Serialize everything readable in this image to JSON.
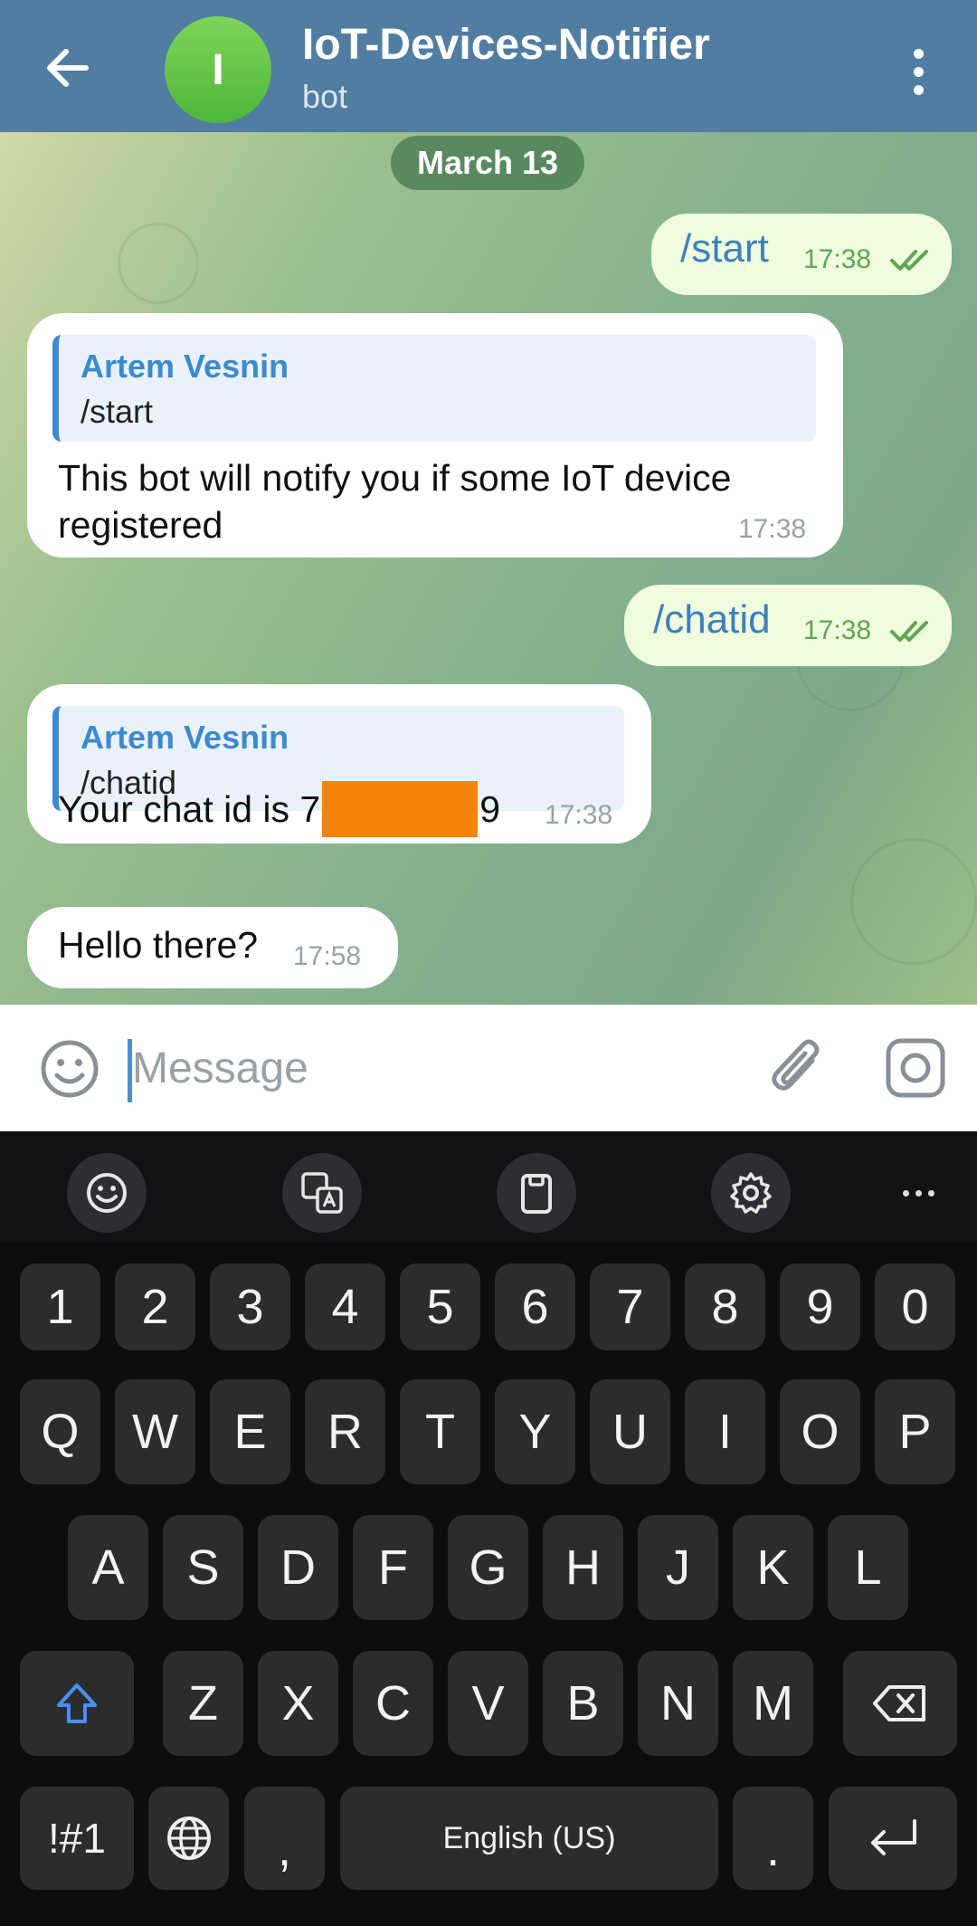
{
  "header": {
    "title": "IoT-Devices-Notifier",
    "subtitle": "bot",
    "avatar_letter": "I",
    "colors": {
      "bar": "#517da2",
      "avatar": "#5ec44a"
    }
  },
  "chat": {
    "date_label": "March 13",
    "messages": [
      {
        "dir": "out",
        "text": "/start",
        "time": "17:38",
        "status": "read"
      },
      {
        "dir": "in",
        "reply_author": "Artem Vesnin",
        "reply_text": "/start",
        "line1": "This bot will notify you if some IoT device",
        "line2": "registered",
        "time": "17:38"
      },
      {
        "dir": "out",
        "text": "/chatid",
        "time": "17:38",
        "status": "read"
      },
      {
        "dir": "in",
        "reply_author": "Artem Vesnin",
        "reply_text": "/chatid",
        "text_prefix": "Your chat id is 7",
        "text_suffix": "9",
        "redacted": true,
        "time": "17:38"
      },
      {
        "dir": "in",
        "text": "Hello there?",
        "time": "17:58"
      }
    ]
  },
  "composer": {
    "placeholder": "Message",
    "icons": [
      "emoji-icon",
      "paperclip-icon",
      "camera-icon"
    ]
  },
  "keyboard": {
    "toolbar_icons": [
      "emoji-icon",
      "translate-icon",
      "clipboard-icon",
      "gear-icon",
      "more-icon"
    ],
    "row_numbers": [
      "1",
      "2",
      "3",
      "4",
      "5",
      "6",
      "7",
      "8",
      "9",
      "0"
    ],
    "row_q": [
      "Q",
      "W",
      "E",
      "R",
      "T",
      "Y",
      "U",
      "I",
      "O",
      "P"
    ],
    "row_a": [
      "A",
      "S",
      "D",
      "F",
      "G",
      "H",
      "J",
      "K",
      "L"
    ],
    "row_z": [
      "Z",
      "X",
      "C",
      "V",
      "B",
      "N",
      "M"
    ],
    "symbols_label": "!#1",
    "comma": ",",
    "space_label": "English (US)",
    "period": "."
  }
}
